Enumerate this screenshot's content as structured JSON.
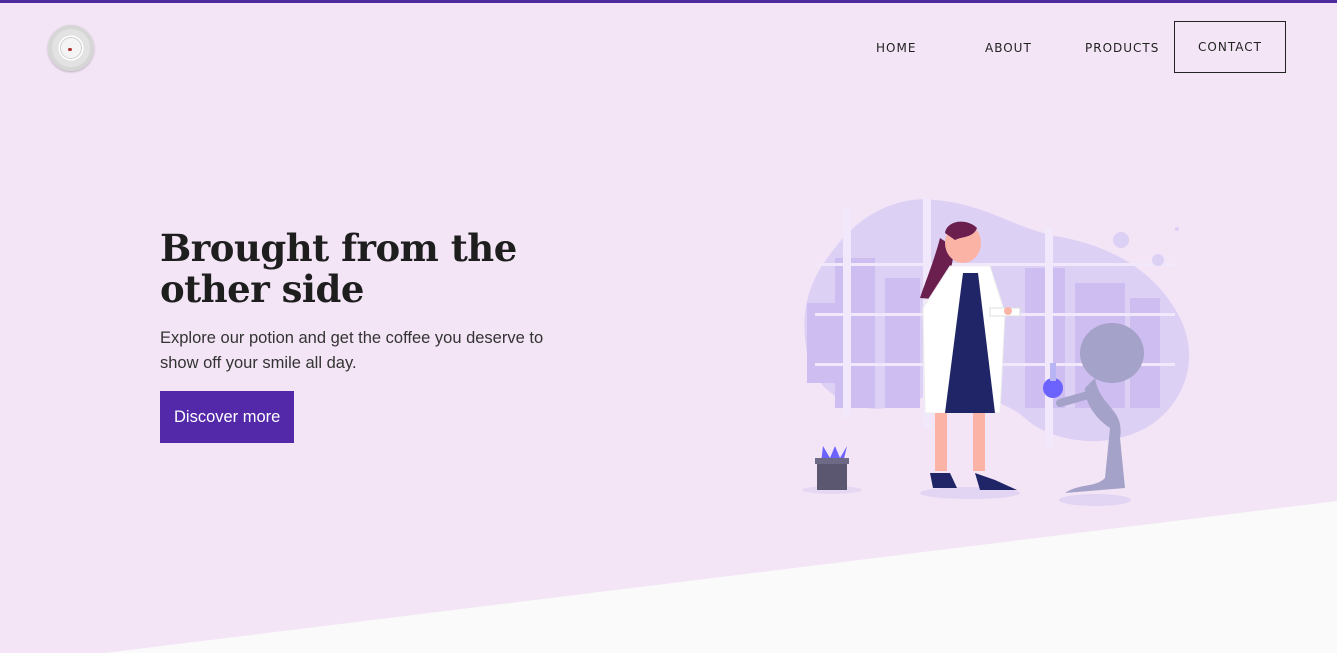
{
  "brand": {
    "logo_icon": "coffee-cup-logo-icon"
  },
  "nav": {
    "items": [
      "HOME",
      "ABOUT",
      "PRODUCTS"
    ],
    "contact_label": "CONTACT"
  },
  "hero": {
    "title_line1": "Brought from the",
    "title_line2": "other side",
    "description": "Explore our potion and get the coffee you deserve to show off your smile all day.",
    "cta_label": "Discover more"
  },
  "illustration": {
    "name": "scientist-and-alien-illustration"
  },
  "colors": {
    "accent": "#5328a9",
    "top_border": "#4f2a9e",
    "background": "#f3e5f6",
    "bottom_background": "#fafafa"
  }
}
